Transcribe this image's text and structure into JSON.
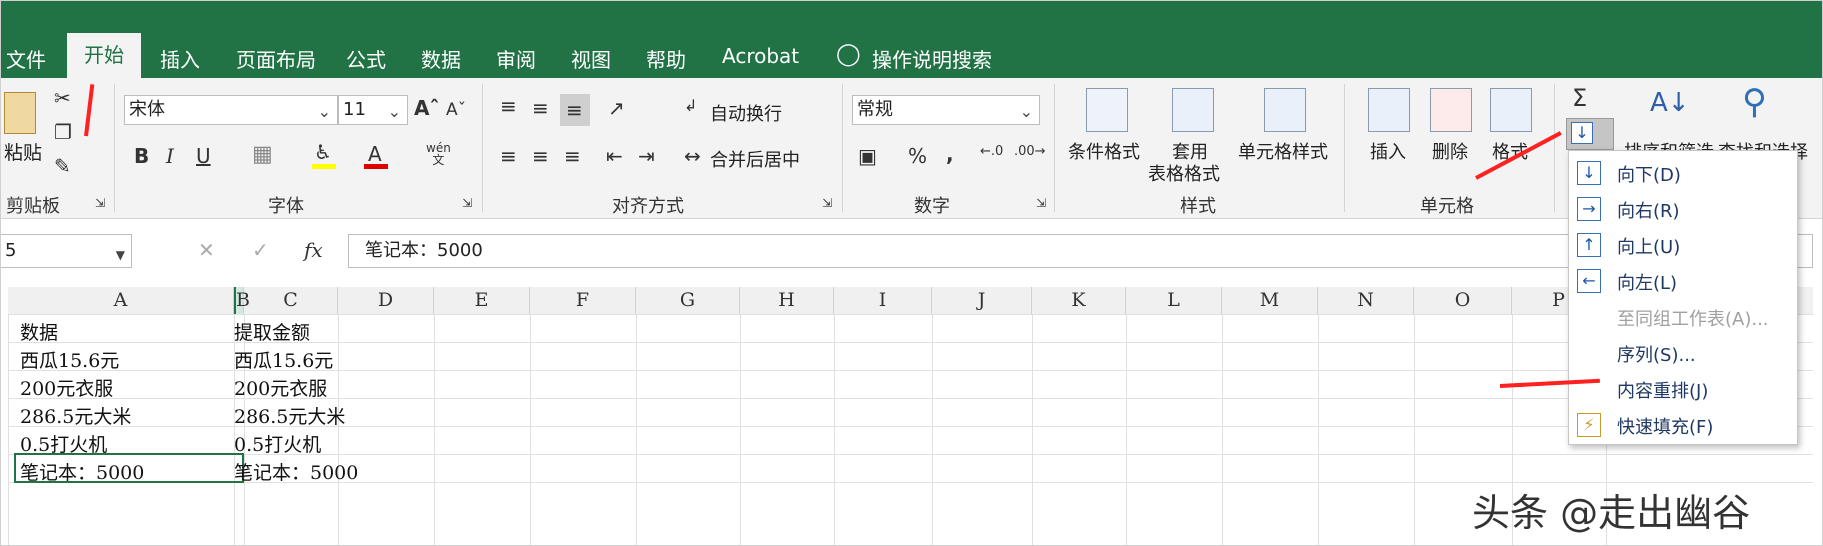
{
  "menubar": {
    "tabs": [
      "文件",
      "开始",
      "插入",
      "页面布局",
      "公式",
      "数据",
      "审阅",
      "视图",
      "帮助",
      "Acrobat"
    ],
    "tell_me": "操作说明搜索"
  },
  "ribbon": {
    "clipboard": {
      "paste": "粘贴",
      "group": "剪贴板"
    },
    "font": {
      "name": "宋体",
      "size": "11",
      "bold": "B",
      "italic": "I",
      "underline": "U",
      "phonetic": "wén",
      "group": "字体"
    },
    "alignment": {
      "wrap": "自动换行",
      "merge": "合并后居中",
      "group": "对齐方式"
    },
    "number": {
      "format": "常规",
      "percent": "%",
      "comma": ",",
      "group": "数字"
    },
    "styles": {
      "conditional": "条件格式",
      "table_line1": "套用",
      "table_line2": "表格格式",
      "cell_styles": "单元格样式",
      "group": "样式"
    },
    "cells": {
      "insert": "插入",
      "delete": "删除",
      "format": "格式",
      "group": "单元格"
    },
    "editing": {
      "sort": "排序和筛选",
      "find": "查找和选择",
      "sigma": "Σ"
    }
  },
  "formula_bar": {
    "name_box": "5",
    "content": "笔记本：5000",
    "fx": "fx"
  },
  "grid": {
    "columns": [
      "A",
      "B",
      "C",
      "D",
      "E",
      "F",
      "G",
      "H",
      "I",
      "J",
      "K",
      "L",
      "M",
      "N",
      "O",
      "P"
    ],
    "col_a": [
      "数据",
      "西瓜15.6元",
      "200元衣服",
      "286.5元大米",
      "0.5打火机",
      "笔记本：5000"
    ],
    "col_c": [
      "提取金额",
      "西瓜15.6元",
      "200元衣服",
      "286.5元大米",
      "0.5打火机",
      "笔记本：5000"
    ]
  },
  "fill_menu": {
    "items": [
      "向下(D)",
      "向右(R)",
      "向上(U)",
      "向左(L)",
      "至同组工作表(A)...",
      "序列(S)...",
      "内容重排(J)",
      "快速填充(F)"
    ]
  },
  "watermark": "头条 @走出幽谷",
  "colors": {
    "excel_green": "#217346",
    "accent_red": "#ff2020",
    "menu_text": "#1f3864"
  }
}
